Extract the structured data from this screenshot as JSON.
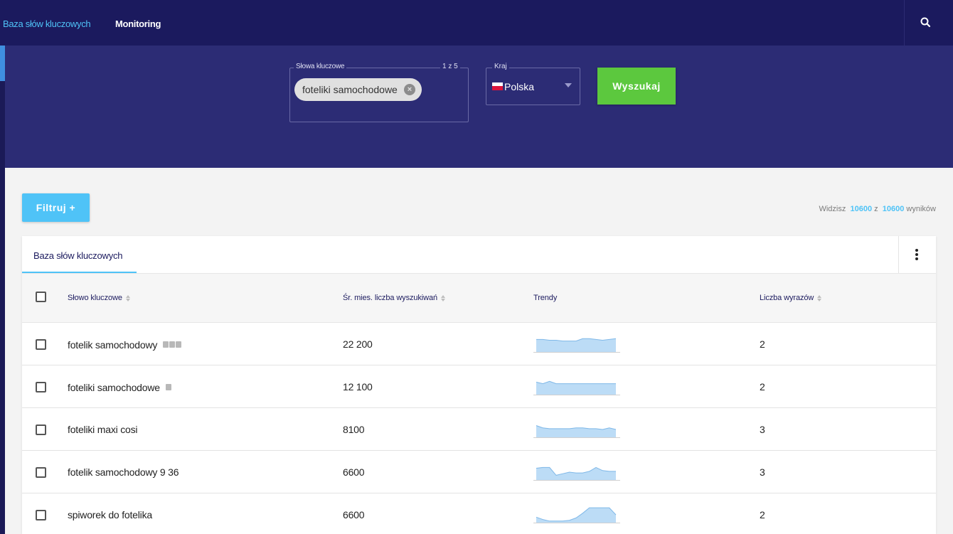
{
  "nav": {
    "items": [
      {
        "label": "Baza słów kluczowych",
        "active": true
      },
      {
        "label": "Monitoring",
        "active": false
      }
    ],
    "search_icon": "search-icon"
  },
  "search": {
    "keywords_label": "Słowa kluczowe",
    "keywords_count": "1 z 5",
    "chip": "foteliki samochodowe",
    "country_label": "Kraj",
    "country_value": "Polska",
    "submit_label": "Wyszukaj"
  },
  "filter_label": "Filtruj +",
  "results": {
    "prefix": "Widzisz",
    "shown": "10600",
    "sep": "z",
    "total": "10600",
    "suffix": "wyników"
  },
  "table": {
    "tab_label": "Baza słów kluczowych",
    "columns": [
      {
        "label": "Słowo kluczowe",
        "sortable": true
      },
      {
        "label": "Śr. mies. liczba wyszukiwań",
        "sortable": true
      },
      {
        "label": "Trendy",
        "sortable": false
      },
      {
        "label": "Liczba wyrazów",
        "sortable": true
      }
    ],
    "rows": [
      {
        "keyword": "fotelik samochodowy",
        "volume": "22 200",
        "words": "2",
        "icons": [
          "image-icon",
          "map-icon",
          "shop-icon"
        ],
        "trend": [
          0.8,
          0.8,
          0.75,
          0.75,
          0.7,
          0.7,
          0.7,
          0.85,
          0.85,
          0.8,
          0.75,
          0.8,
          0.85
        ]
      },
      {
        "keyword": "foteliki samochodowe",
        "volume": "12 100",
        "words": "2",
        "icons": [
          "map-icon"
        ],
        "trend": [
          0.8,
          0.7,
          0.85,
          0.7,
          0.7,
          0.7,
          0.7,
          0.7,
          0.7,
          0.7,
          0.7,
          0.7,
          0.7
        ]
      },
      {
        "keyword": "foteliki maxi cosi",
        "volume": "8100",
        "words": "3",
        "icons": [],
        "trend": [
          0.75,
          0.6,
          0.55,
          0.55,
          0.55,
          0.55,
          0.6,
          0.6,
          0.55,
          0.55,
          0.5,
          0.6,
          0.5
        ]
      },
      {
        "keyword": "fotelik samochodowy 9 36",
        "volume": "6600",
        "words": "3",
        "icons": [],
        "trend": [
          0.75,
          0.8,
          0.8,
          0.3,
          0.4,
          0.5,
          0.45,
          0.45,
          0.55,
          0.8,
          0.6,
          0.55,
          0.55
        ]
      },
      {
        "keyword": "spiworek do fotelika",
        "volume": "6600",
        "words": "2",
        "icons": [],
        "trend": [
          0.35,
          0.2,
          0.1,
          0.1,
          0.1,
          0.15,
          0.3,
          0.6,
          0.95,
          0.95,
          0.95,
          0.95,
          0.5
        ]
      }
    ]
  }
}
